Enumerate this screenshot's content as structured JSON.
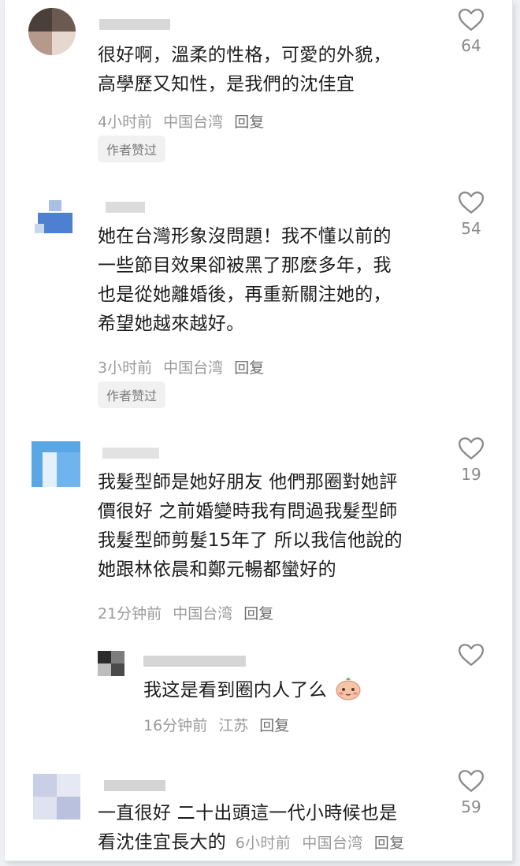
{
  "comments": [
    {
      "text_lines": [
        "很好啊，溫柔的性格，可愛的外貌，",
        "高學歷又知性，是我們的沈佳宜"
      ],
      "time": "4小时前",
      "location": "中国台湾",
      "reply": "回复",
      "badge": "作者赞过",
      "likes": "64"
    },
    {
      "text_lines": [
        "她在台灣形象沒問題！我不懂以前的",
        "一些節目效果卻被黑了那麽多年，我",
        "也是從她離婚後，再重新關注她的，",
        "希望她越來越好。"
      ],
      "time": "3小时前",
      "location": "中国台湾",
      "reply": "回复",
      "badge": "作者赞过",
      "likes": "54"
    },
    {
      "text_lines": [
        "我髮型師是她好朋友 他們那圈對她評",
        "價很好 之前婚變時我有問過我髮型師",
        "我髮型師剪髮15年了 所以我信他說的",
        "她跟林依晨和鄭元暢都蠻好的"
      ],
      "time": "21分钟前",
      "location": "中国台湾",
      "reply": "回复",
      "likes": "19"
    },
    {
      "text_lines": [
        "我这是看到圈内人了么"
      ],
      "time": "16分钟前",
      "location": "江苏",
      "reply": "回复"
    },
    {
      "text_lines": [
        "一直很好 二十出頭這一代小時候也是",
        "看沈佳宜長大的"
      ],
      "time": "6小时前",
      "location": "中国台湾",
      "reply": "回复",
      "likes": "59"
    }
  ],
  "icons": {
    "like": "heart-outline-icon",
    "emoji": "shy-face-emoji-icon"
  },
  "colors": {
    "text": "#1c1c1c",
    "meta": "#9a9a9a",
    "badge_bg": "#f1f1f1",
    "heart_stroke": "#8a8a8a"
  }
}
